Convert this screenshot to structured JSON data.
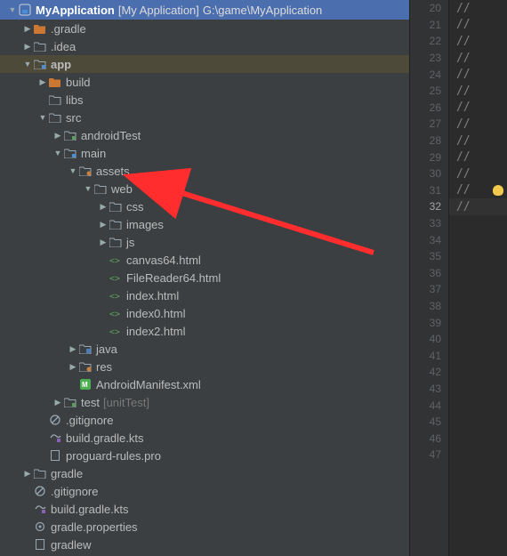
{
  "root": {
    "project_name": "MyApplication",
    "module_label": "[My Application]",
    "path": "G:\\game\\MyApplication"
  },
  "tree": [
    {
      "depth": 1,
      "chev": "▶",
      "icon": "folder-orange",
      "label": ".gradle"
    },
    {
      "depth": 1,
      "chev": "▶",
      "icon": "folder",
      "label": ".idea"
    },
    {
      "depth": 1,
      "chev": "▼",
      "icon": "module",
      "label": "app",
      "bold": true,
      "highlight": true
    },
    {
      "depth": 2,
      "chev": "▶",
      "icon": "folder-orange",
      "label": "build"
    },
    {
      "depth": 2,
      "chev": "",
      "icon": "folder",
      "label": "libs"
    },
    {
      "depth": 2,
      "chev": "▼",
      "icon": "folder",
      "label": "src"
    },
    {
      "depth": 3,
      "chev": "▶",
      "icon": "module-test",
      "label": "androidTest"
    },
    {
      "depth": 3,
      "chev": "▼",
      "icon": "module",
      "label": "main"
    },
    {
      "depth": 4,
      "chev": "▼",
      "icon": "resource-folder",
      "label": "assets"
    },
    {
      "depth": 5,
      "chev": "▼",
      "icon": "folder",
      "label": "web"
    },
    {
      "depth": 6,
      "chev": "▶",
      "icon": "folder",
      "label": "css"
    },
    {
      "depth": 6,
      "chev": "▶",
      "icon": "folder",
      "label": "images"
    },
    {
      "depth": 6,
      "chev": "▶",
      "icon": "folder",
      "label": "js"
    },
    {
      "depth": 6,
      "chev": "",
      "icon": "html-file",
      "label": "canvas64.html"
    },
    {
      "depth": 6,
      "chev": "",
      "icon": "html-file",
      "label": "FileReader64.html"
    },
    {
      "depth": 6,
      "chev": "",
      "icon": "html-file",
      "label": "index.html"
    },
    {
      "depth": 6,
      "chev": "",
      "icon": "html-file",
      "label": "index0.html"
    },
    {
      "depth": 6,
      "chev": "",
      "icon": "html-file",
      "label": "index2.html"
    },
    {
      "depth": 4,
      "chev": "▶",
      "icon": "src-folder",
      "label": "java"
    },
    {
      "depth": 4,
      "chev": "▶",
      "icon": "resource-folder",
      "label": "res"
    },
    {
      "depth": 4,
      "chev": "",
      "icon": "manifest",
      "label": "AndroidManifest.xml"
    },
    {
      "depth": 3,
      "chev": "▶",
      "icon": "module-test",
      "label": "test",
      "annot": "[unitTest]"
    },
    {
      "depth": 2,
      "chev": "",
      "icon": "gitignore",
      "label": ".gitignore"
    },
    {
      "depth": 2,
      "chev": "",
      "icon": "gradle-kts",
      "label": "build.gradle.kts"
    },
    {
      "depth": 2,
      "chev": "",
      "icon": "file",
      "label": "proguard-rules.pro"
    },
    {
      "depth": 1,
      "chev": "▶",
      "icon": "folder",
      "label": "gradle"
    },
    {
      "depth": 1,
      "chev": "",
      "icon": "gitignore",
      "label": ".gitignore"
    },
    {
      "depth": 1,
      "chev": "",
      "icon": "gradle-kts",
      "label": "build.gradle.kts"
    },
    {
      "depth": 1,
      "chev": "",
      "icon": "gear",
      "label": "gradle.properties"
    },
    {
      "depth": 1,
      "chev": "",
      "icon": "file",
      "label": "gradlew"
    }
  ],
  "gutter": {
    "start": 20,
    "end": 47,
    "current": 32,
    "bulb_line": 31
  },
  "code_comment": "//",
  "code_comment_rows": [
    "20",
    "21",
    "22",
    "23",
    "24",
    "25",
    "26",
    "27",
    "28",
    "29",
    "30",
    "31",
    "32"
  ]
}
